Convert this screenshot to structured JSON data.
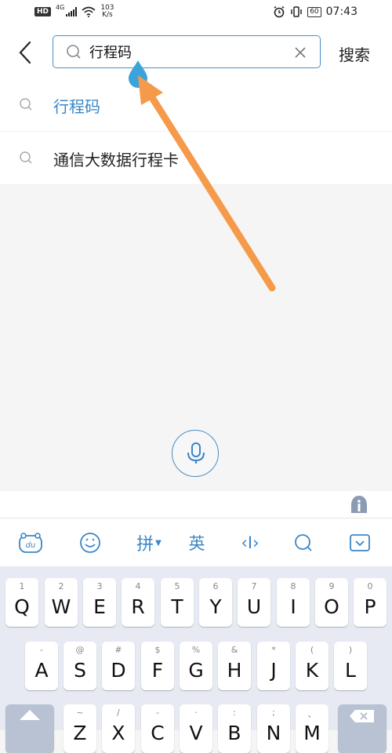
{
  "status_bar": {
    "hd": "HD",
    "network": "4G",
    "speed_value": "103",
    "speed_unit": "K/s",
    "battery": "60",
    "time": "07:43"
  },
  "header": {
    "search_value": "行程码",
    "search_button": "搜索"
  },
  "suggestions": [
    {
      "text": "行程码",
      "highlighted": true
    },
    {
      "text": "通信大数据行程卡",
      "highlighted": false
    }
  ],
  "keyboard": {
    "toolbar": {
      "pinyin_label": "拼",
      "english_label": "英",
      "cursor_label": "‹I›"
    },
    "rows": [
      [
        {
          "hint": "1",
          "label": "Q"
        },
        {
          "hint": "2",
          "label": "W"
        },
        {
          "hint": "3",
          "label": "E"
        },
        {
          "hint": "4",
          "label": "R"
        },
        {
          "hint": "5",
          "label": "T"
        },
        {
          "hint": "6",
          "label": "Y"
        },
        {
          "hint": "7",
          "label": "U"
        },
        {
          "hint": "8",
          "label": "I"
        },
        {
          "hint": "9",
          "label": "O"
        },
        {
          "hint": "0",
          "label": "P"
        }
      ],
      [
        {
          "hint": "-",
          "label": "A"
        },
        {
          "hint": "@",
          "label": "S"
        },
        {
          "hint": "#",
          "label": "D"
        },
        {
          "hint": "$",
          "label": "F"
        },
        {
          "hint": "%",
          "label": "G"
        },
        {
          "hint": "&",
          "label": "H"
        },
        {
          "hint": "*",
          "label": "J"
        },
        {
          "hint": "(",
          "label": "K"
        },
        {
          "hint": ")",
          "label": "L"
        }
      ],
      [
        {
          "hint": "~",
          "label": "Z"
        },
        {
          "hint": "/",
          "label": "X"
        },
        {
          "hint": "-",
          "label": "C"
        },
        {
          "hint": "·",
          "label": "V"
        },
        {
          "hint": ":",
          "label": "B"
        },
        {
          "hint": ";",
          "label": "N"
        },
        {
          "hint": "、",
          "label": "M"
        }
      ]
    ]
  },
  "colors": {
    "accent": "#3a86c7",
    "arrow": "#f59a4a",
    "keyboard_bg": "#e7eaf2"
  }
}
